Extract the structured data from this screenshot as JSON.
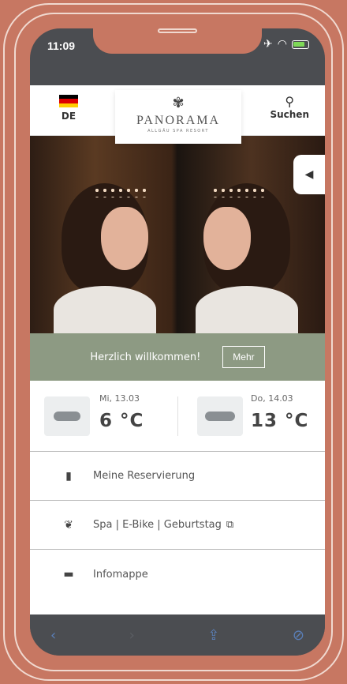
{
  "status_bar": {
    "time": "11:09"
  },
  "header": {
    "language": "DE",
    "logo": {
      "name": "PANORAMA",
      "subtitle": "ALLGÄU SPA RESORT"
    },
    "search_label": "Suchen"
  },
  "welcome": {
    "text": "Herzlich willkommen!",
    "button_label": "Mehr"
  },
  "weather": [
    {
      "date": "Mi, 13.03",
      "temp": "6 °C",
      "icon": "cloud-rain-icon"
    },
    {
      "date": "Do, 14.03",
      "temp": "13 °C",
      "icon": "cloud-icon"
    }
  ],
  "menu": [
    {
      "label": "Meine Reservierung",
      "icon": "luggage-icon"
    },
    {
      "label": "Spa | E-Bike | Geburtstag",
      "icon": "lotus-icon",
      "external": true
    },
    {
      "label": "Infomappe",
      "icon": "book-icon"
    }
  ],
  "colors": {
    "background": "#c77762",
    "welcome_bar": "#8d9a83",
    "browser_bar": "#4b4d51",
    "accent": "#5a7fb8"
  }
}
